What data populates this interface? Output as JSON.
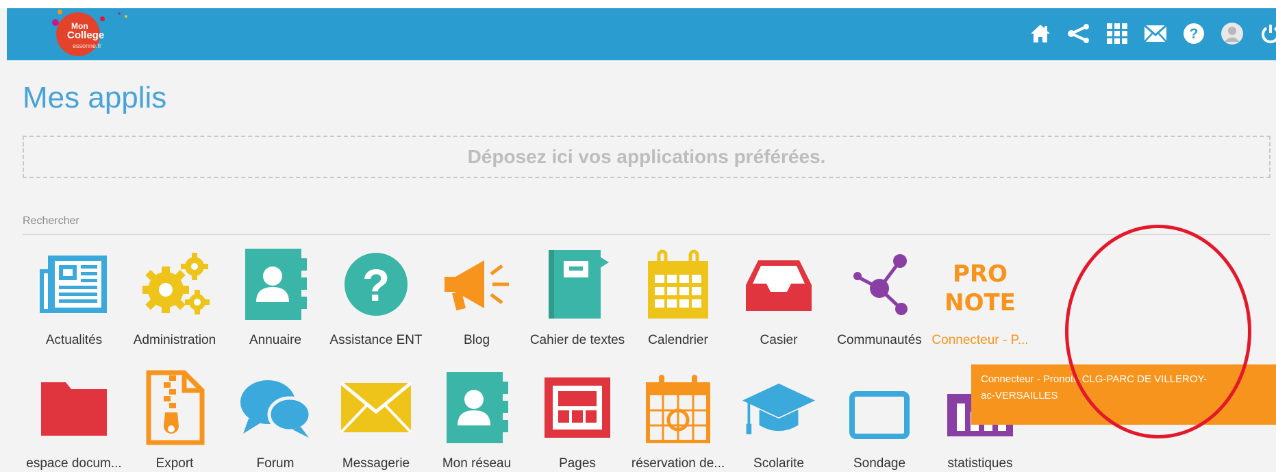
{
  "header": {
    "logo_line1": "Mon",
    "logo_line2": "College",
    "logo_line3": "essonne.fr",
    "nav_icons": [
      "home-icon",
      "share-icon",
      "apps-grid-icon",
      "mail-icon",
      "help-icon",
      "user-avatar-icon",
      "power-icon"
    ]
  },
  "page": {
    "title": "Mes applis",
    "dropzone_text": "Déposez ici vos applications préférées.",
    "search_placeholder": "Rechercher"
  },
  "apps_row1": [
    {
      "label": "Actualités",
      "icon": "newspaper-icon",
      "color": "#3ba9dc"
    },
    {
      "label": "Administration",
      "icon": "gears-icon",
      "color": "#efc41a"
    },
    {
      "label": "Annuaire",
      "icon": "contact-book-icon",
      "color": "#3bb5a8"
    },
    {
      "label": "Assistance ENT",
      "icon": "question-circle-icon",
      "color": "#3bb5a8"
    },
    {
      "label": "Blog",
      "icon": "megaphone-icon",
      "color": "#f7941d"
    },
    {
      "label": "Cahier de textes",
      "icon": "notebook-icon",
      "color": "#3bb5a8"
    },
    {
      "label": "Calendrier",
      "icon": "calendar-icon",
      "color": "#efc41a"
    },
    {
      "label": "Casier",
      "icon": "inbox-tray-icon",
      "color": "#e0353e"
    },
    {
      "label": "Communautés",
      "icon": "share-nodes-icon",
      "color": "#8a3fa4"
    },
    {
      "label": "Connecteur - P...",
      "icon": "pronote-logo-icon",
      "color": "#f7941d"
    }
  ],
  "apps_row2": [
    {
      "label": "espace docum...",
      "icon": "folder-icon",
      "color": "#e0353e"
    },
    {
      "label": "Export",
      "icon": "zip-file-icon",
      "color": "#f7941d"
    },
    {
      "label": "Forum",
      "icon": "chat-bubbles-icon",
      "color": "#3ba9dc"
    },
    {
      "label": "Messagerie",
      "icon": "envelope-icon",
      "color": "#efc41a"
    },
    {
      "label": "Mon réseau",
      "icon": "contact-book-icon",
      "color": "#3bb5a8"
    },
    {
      "label": "Pages",
      "icon": "web-page-icon",
      "color": "#e0353e"
    },
    {
      "label": "réservation de...",
      "icon": "calendar-booking-icon",
      "color": "#f7941d"
    },
    {
      "label": "Scolarite",
      "icon": "graduation-cap-icon",
      "color": "#3ba9dc"
    },
    {
      "label": "Sondage",
      "icon": "poll-icon",
      "color": "#3ba9dc"
    },
    {
      "label": "statistiques",
      "icon": "bar-chart-icon",
      "color": "#8a3fa4"
    }
  ],
  "tooltip": {
    "line1": "Connecteur - Pronote CLG-PARC DE VILLEROY-",
    "line2": "ac-VERSAILLES"
  },
  "colors": {
    "header_bg": "#2a9cd0",
    "title": "#4aa3d8",
    "tooltip_bg": "#f7941d",
    "annotation_circle": "#e3192b"
  }
}
